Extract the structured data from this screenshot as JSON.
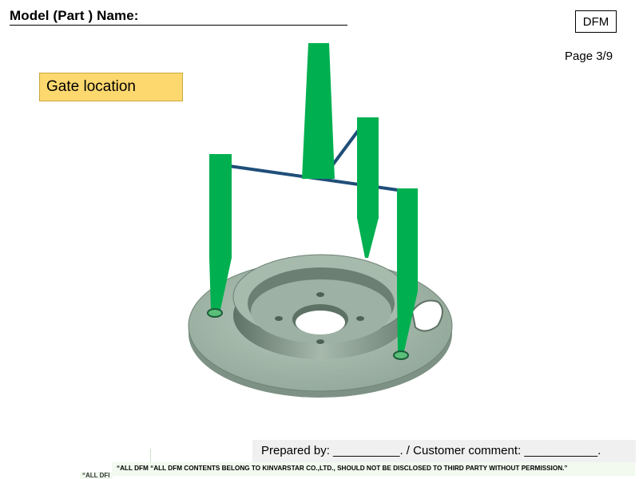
{
  "header": {
    "title": "Model (Part ) Name:",
    "dfm_badge": "DFM",
    "page": "Page 3/9"
  },
  "section": {
    "label": "Gate location"
  },
  "footer": {
    "prepared": "Prepared by: __________. / Customer comment: ___________.",
    "disclaimer": "“ALL DFM “ALL DFM CONTENTS BELONG TO KINVARSTAR CO.,LTD., SHOULD NOT BE DISCLOSED TO THIRD PARTY WITHOUT PERMISSION.”",
    "fragment": "“ALL DFI"
  },
  "colors": {
    "runner": "#00b050",
    "cold_slug_line": "#1f4e79",
    "part": "#9fb5a7",
    "label_bg": "#fdd86e"
  }
}
